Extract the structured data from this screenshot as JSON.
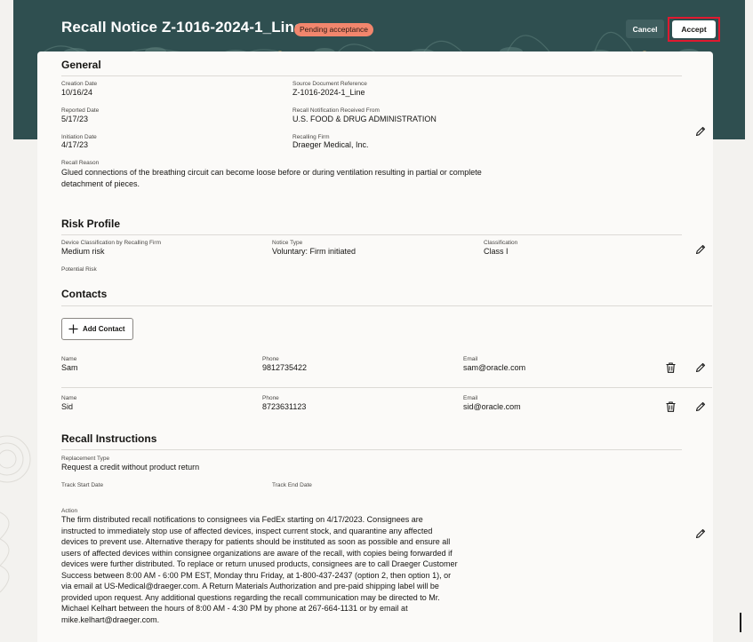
{
  "header": {
    "title": "Recall Notice Z-1016-2024-1_Line",
    "status_badge": "Pending acceptance",
    "cancel_label": "Cancel",
    "accept_label": "Accept"
  },
  "general": {
    "title": "General",
    "creation_date_label": "Creation Date",
    "creation_date": "10/16/24",
    "source_doc_label": "Source Document Reference",
    "source_doc": "Z-1016-2024-1_Line",
    "reported_date_label": "Reported Date",
    "reported_date": "5/17/23",
    "received_from_label": "Recall Notification Received From",
    "received_from": "U.S. FOOD & DRUG ADMINISTRATION",
    "initiation_date_label": "Initiation Date",
    "initiation_date": "4/17/23",
    "recalling_firm_label": "Recalling Firm",
    "recalling_firm": "Draeger Medical, Inc.",
    "recall_reason_label": "Recall Reason",
    "recall_reason_lines": [
      "Glued connections of the breathing circuit can become loose before or during ventilation resulting in partial or complete",
      "detachment of pieces."
    ]
  },
  "risk_profile": {
    "title": "Risk Profile",
    "device_class_label": "Device Classification by Recalling Firm",
    "device_class": "Medium risk",
    "notice_type_label": "Notice Type",
    "notice_type": "Voluntary: Firm initiated",
    "classification_label": "Classification",
    "classification": "Class I",
    "potential_risk_label": "Potential Risk"
  },
  "contacts": {
    "title": "Contacts",
    "add_label": "Add Contact",
    "name_label": "Name",
    "phone_label": "Phone",
    "email_label": "Email",
    "rows": [
      {
        "name": "Sam",
        "phone": "9812735422",
        "email": "sam@oracle.com"
      },
      {
        "name": "Sid",
        "phone": "8723631123",
        "email": "sid@oracle.com"
      }
    ]
  },
  "recall_instructions": {
    "title": "Recall Instructions",
    "replacement_type_label": "Replacement Type",
    "replacement_type": "Request a credit without product return",
    "track_start_label": "Track Start Date",
    "track_end_label": "Track End Date",
    "action_label": "Action",
    "action_lines": [
      "The firm distributed recall notifications to consignees via FedEx starting on 4/17/2023. Consignees are",
      "instructed to immediately stop use of affected devices, inspect current stock, and quarantine any affected",
      "devices to prevent use. Alternative therapy for patients should be instituted as soon as possible and ensure all",
      "users of affected devices within consignee organizations are aware of the recall, with copies being forwarded if",
      "devices were further distributed. To replace or return unused products, consignees are to call Draeger Customer",
      "Success between 8:00 AM - 6:00 PM EST, Monday thru Friday, at 1-800-437-2437 (option 2, then option 1), or",
      "via email at US-Medical@draeger.com. A Return Materials Authorization and pre-paid shipping label will be",
      "provided upon request. Any additional questions regarding the recall communication may be directed to Mr.",
      "Michael Kelhart between the hours of 8:00 AM - 4:30 PM by phone at 267-664-1131 or by email at",
      "mike.kelhart@draeger.com."
    ]
  },
  "icons": {
    "edit": "pencil-icon",
    "delete": "trash-icon",
    "add": "plus-icon"
  },
  "colors": {
    "header_bg": "#2f4f50",
    "badge_bg": "#f2866d",
    "highlight": "#e0192f",
    "card_bg": "#fbfaf8"
  }
}
